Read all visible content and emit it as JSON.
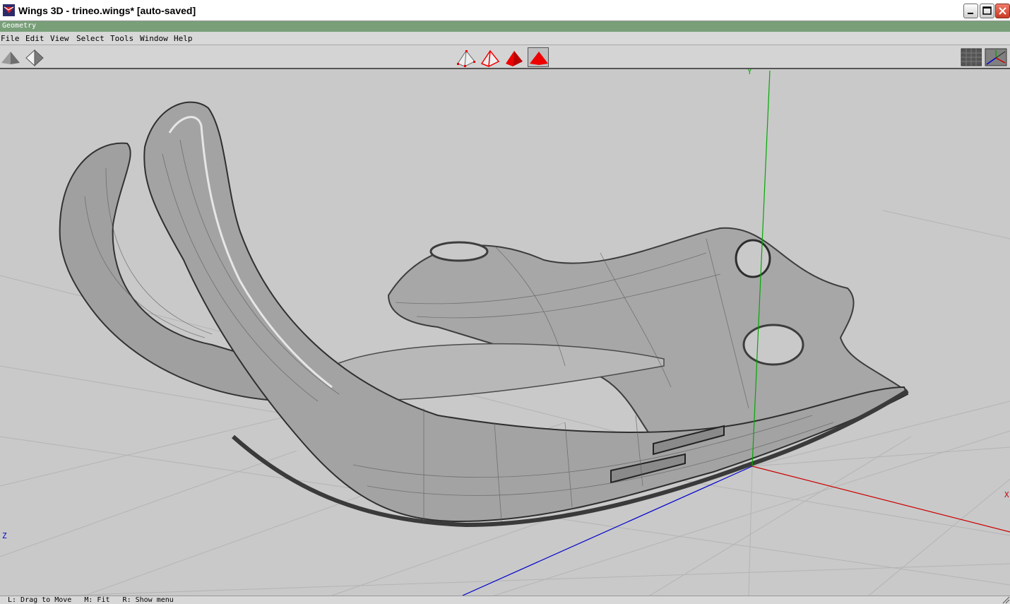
{
  "window": {
    "title": "Wings 3D - trineo.wings* [auto-saved]"
  },
  "mode_bar": {
    "label": "Geometry"
  },
  "menu": [
    "File",
    "Edit",
    "View",
    "Select",
    "Tools",
    "Window",
    "Help"
  ],
  "toolbar": {
    "left": [
      "smooth-shade-icon",
      "wireframe-shade-icon"
    ],
    "selection_modes": [
      "vertex-mode-icon",
      "edge-mode-icon",
      "face-mode-icon",
      "body-mode-icon"
    ],
    "active_selection_mode": "body-mode-icon",
    "right": [
      "groundplane-toggle-icon",
      "axes-toggle-icon"
    ]
  },
  "axes": {
    "y": "Y",
    "x": "X",
    "z": "Z"
  },
  "colors": {
    "mode_bar": "#799f79",
    "x_axis": "#cc0000",
    "y_axis": "#00aa00",
    "z_axis": "#0000cc",
    "selection_red": "#e00000"
  },
  "status": {
    "text": "L: Drag to Move   M: Fit   R: Show menu"
  }
}
